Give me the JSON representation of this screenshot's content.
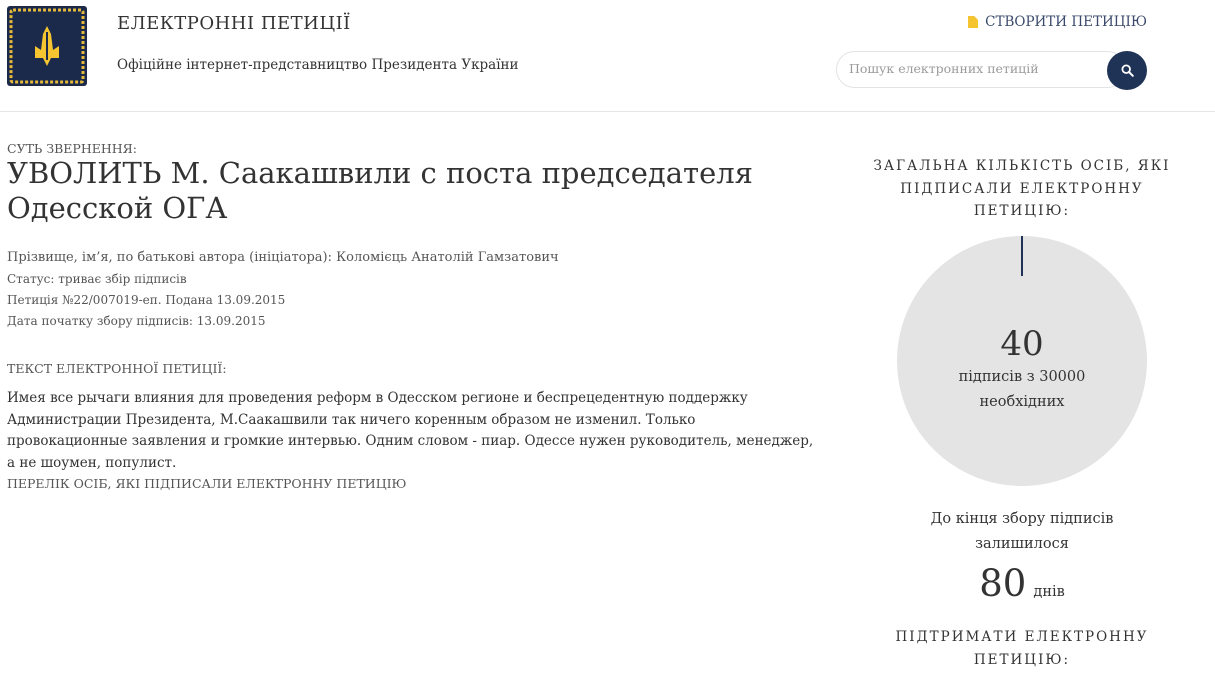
{
  "header": {
    "title": "ЕЛЕКТРОННІ ПЕТИЦІЇ",
    "subtitle": "Офіційне інтернет-представництво Президента України",
    "create_link": "СТВОРИТИ ПЕТИЦІЮ",
    "search_placeholder": "Пошук електронних петицій"
  },
  "petition": {
    "essence_label": "СУТЬ ЗВЕРНЕННЯ:",
    "title": "УВОЛИТЬ М. Саакашвили с поста председателя Одесской ОГА",
    "author_line": "Прізвище, ім’я, по батькові автора (ініціатора): Коломієць Анатолій Гамзатович",
    "status_line": "Статус: триває збір підписів",
    "number_line": "Петиція №22/007019-еп. Подана 13.09.2015",
    "start_date_line": "Дата початку збору підписів: 13.09.2015",
    "text_label": "ТЕКСТ ЕЛЕКТРОННОЇ ПЕТИЦІЇ:",
    "text": "Имея все рычаги влияния для проведения реформ в Одесском регионе и беспрецедентную поддержку Администрации Президента, М.Саакашвили так ничего коренным образом не изменил. Только провокационные заявления и громкие интервью. Одним словом - пиар.  Одессе нужен руководитель, менеджер, а не шоумен, популист.",
    "signers_link": "ПЕРЕЛІК ОСІБ, ЯКІ ПІДПИСАЛИ ЕЛЕКТРОННУ ПЕТИЦІЮ"
  },
  "stats": {
    "total_label": "ЗАГАЛЬНА КІЛЬКІСТЬ ОСІБ, ЯКІ ПІДПИСАЛИ ЕЛЕКТРОННУ ПЕТИЦІЮ:",
    "signatures": 40,
    "required": 30000,
    "count": "40",
    "of_required": "підписів з 30000",
    "necessary": "необхідних",
    "remaining_label": "До кінця збору підписів залишилося",
    "days": "80",
    "days_unit": "днів",
    "support_label": "ПІДТРИМАТИ ЕЛЕКТРОННУ ПЕТИЦІЮ:"
  },
  "colors": {
    "navy": "#1f3357",
    "gold": "#f4c531",
    "circle": "#e4e4e4"
  },
  "icons": [
    "coat-of-arms-logo",
    "document-icon",
    "search-icon"
  ]
}
